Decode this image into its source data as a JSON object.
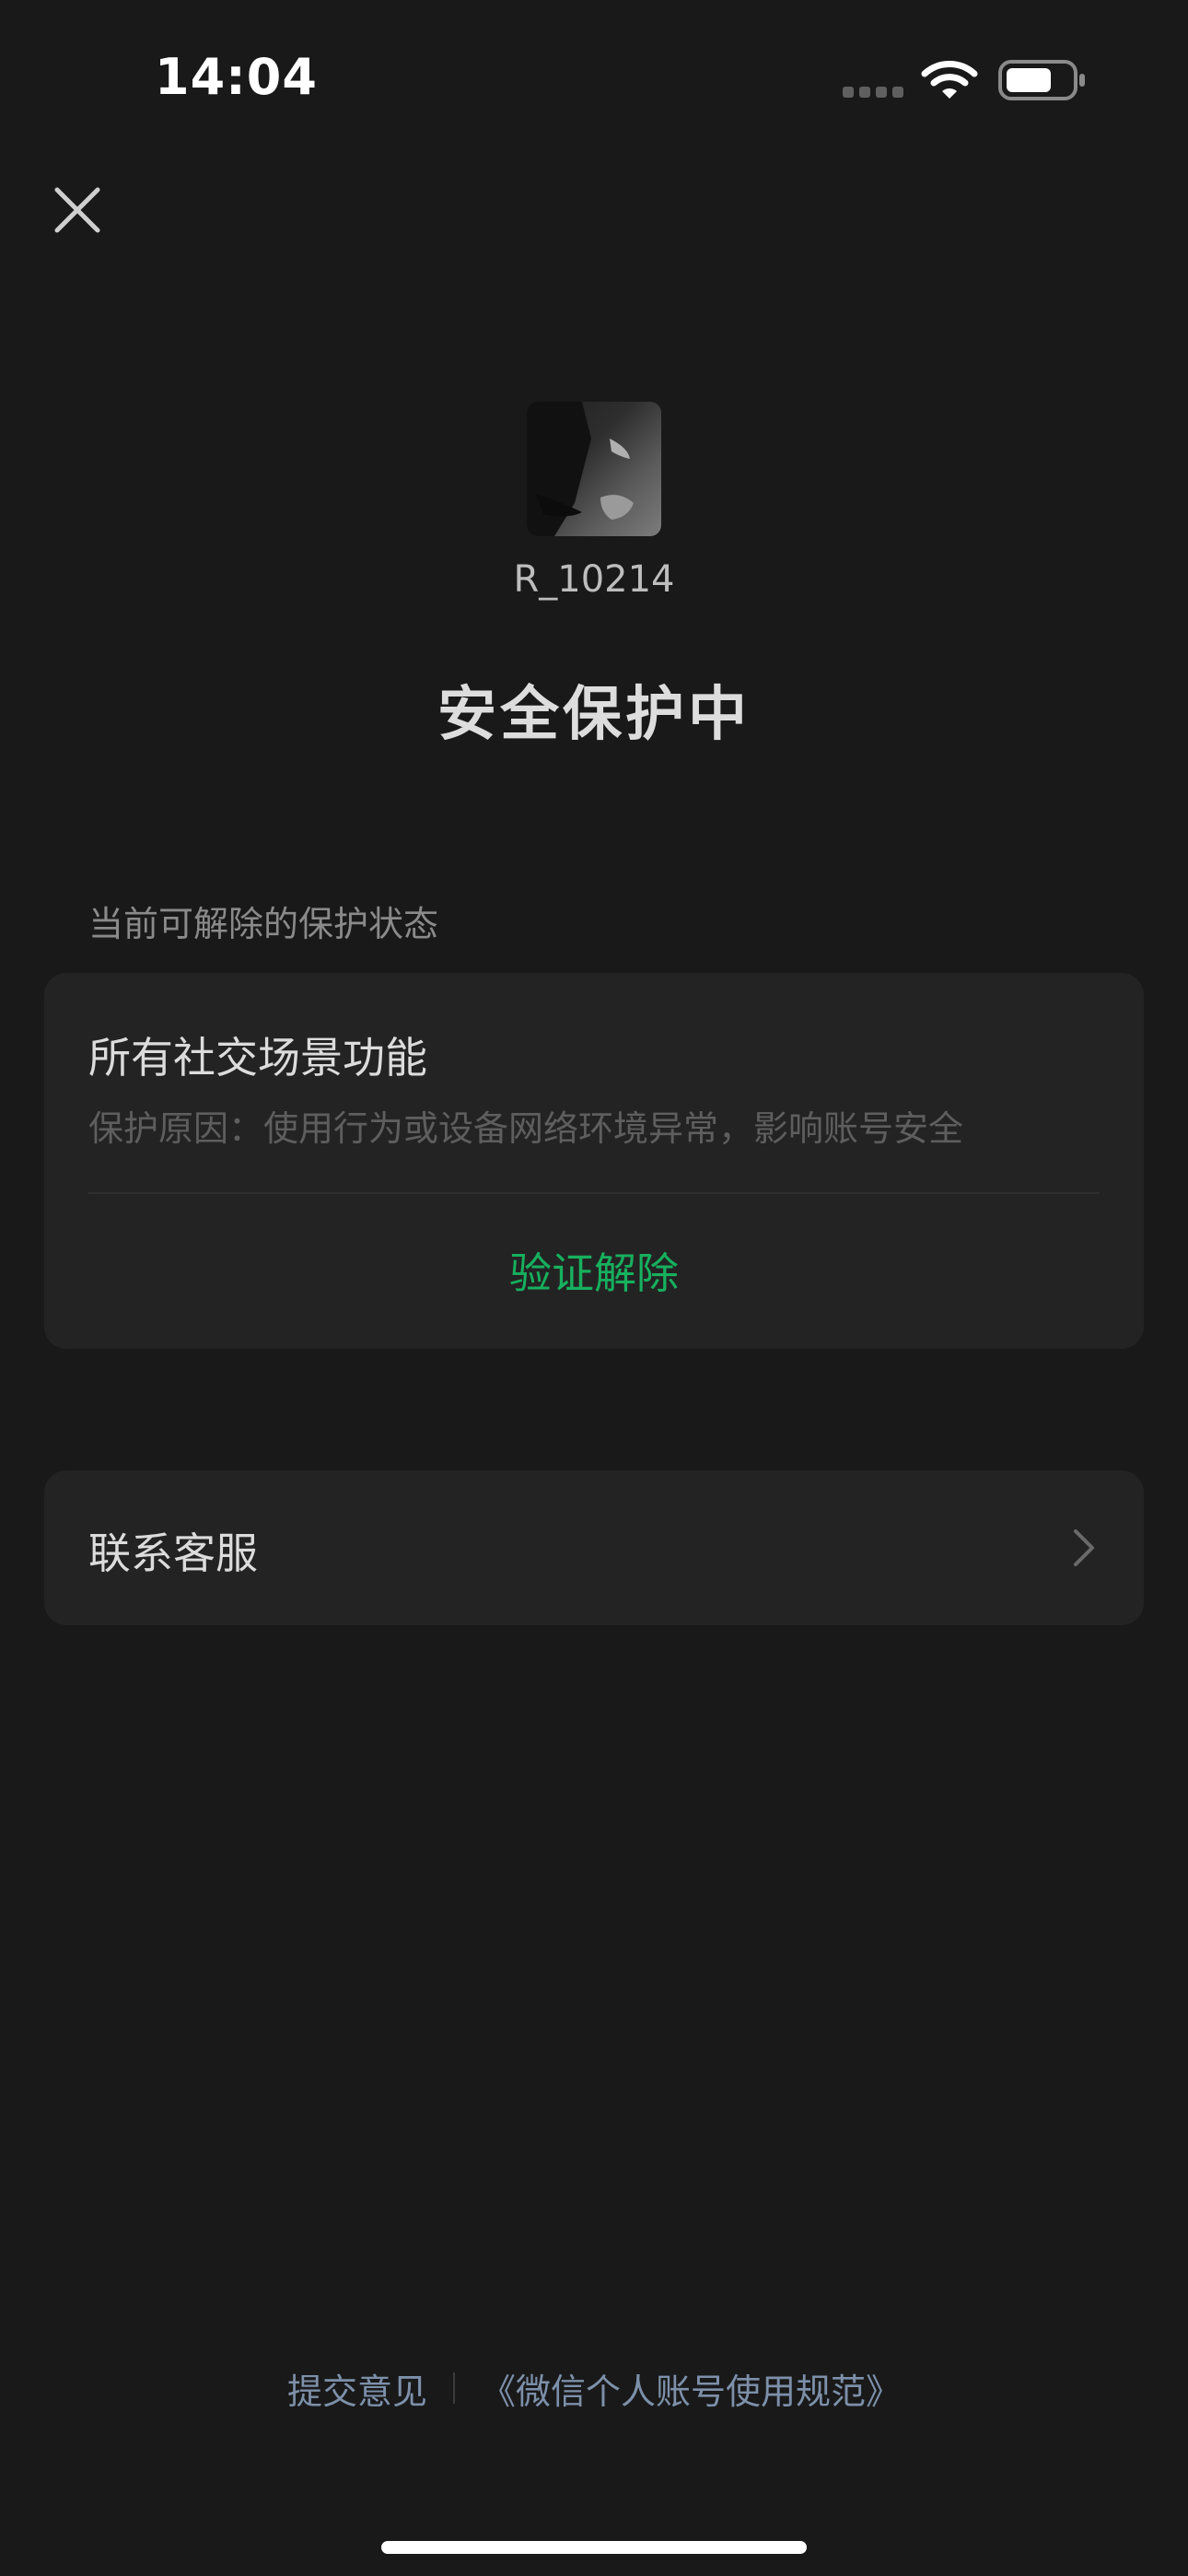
{
  "status_bar": {
    "time": "14:04"
  },
  "profile": {
    "username": "R_10214"
  },
  "page": {
    "title": "安全保护中"
  },
  "protection": {
    "section_label": "当前可解除的保护状态",
    "feature_title": "所有社交场景功能",
    "reason": "保护原因：使用行为或设备网络环境异常，影响账号安全",
    "verify_label": "验证解除"
  },
  "contact": {
    "label": "联系客服"
  },
  "footer": {
    "feedback_label": "提交意见",
    "policy_label": "《微信个人账号使用规范》"
  },
  "colors": {
    "background": "#191919",
    "card": "#232323",
    "accent_green": "#17b05e",
    "link_blue": "#7d90aa"
  },
  "icons": [
    "close-icon",
    "wifi-icon",
    "battery-icon",
    "chevron-right-icon"
  ]
}
